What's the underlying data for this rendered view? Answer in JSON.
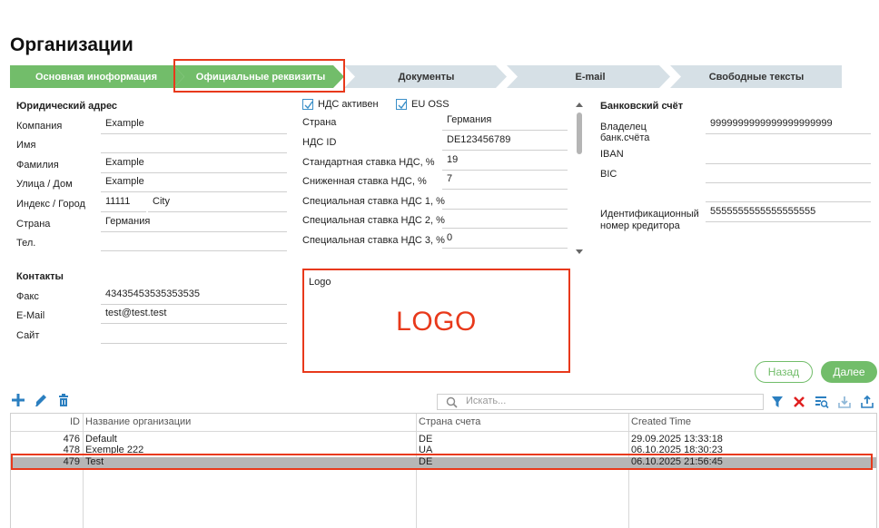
{
  "page": {
    "title": "Организации"
  },
  "steps": [
    {
      "label": "Основная иноформация",
      "state": "done"
    },
    {
      "label": "Официальные реквизиты",
      "state": "active"
    },
    {
      "label": "Документы",
      "state": "todo"
    },
    {
      "label": "E-mail",
      "state": "todo"
    },
    {
      "label": "Свободные тексты",
      "state": "todo"
    }
  ],
  "legal_address": {
    "title": "Юридический адрес",
    "company_label": "Компания",
    "company_value": "Example",
    "first_name_label": "Имя",
    "first_name_value": "",
    "last_name_label": "Фамилия",
    "last_name_value": "Example",
    "street_label": "Улица / Дом",
    "street_value": "Example",
    "zip_city_label": "Индекс / Город",
    "zip_value": "11111",
    "city_value": "City",
    "country_label": "Страна",
    "country_value": "Германия",
    "phone_label": "Тел.",
    "phone_value": ""
  },
  "contacts": {
    "title": "Контакты",
    "fax_label": "Факс",
    "fax_value": "43435453535353535",
    "email_label": "E-Mail",
    "email_value": "test@test.test",
    "site_label": "Сайт",
    "site_value": ""
  },
  "vat": {
    "vat_active_label": "НДС активен",
    "vat_active_checked": true,
    "eu_oss_label": "EU OSS",
    "eu_oss_checked": true,
    "country_label": "Страна",
    "country_value": "Германия",
    "vat_id_label": "НДС ID",
    "vat_id_value": "DE123456789",
    "std_rate_label": "Стандартная ставка НДС, %",
    "std_rate_value": "19",
    "reduced_rate_label": "Сниженная ставка НДС, %",
    "reduced_rate_value": "7",
    "special1_label": "Специальная ставка НДС 1, %",
    "special1_value": "",
    "special2_label": "Специальная ставка НДС 2, %",
    "special2_value": "",
    "special3_label": "Специальная ставка НДС 3, %",
    "special3_value": "0"
  },
  "logo": {
    "label": "Logo",
    "text": "LOGO"
  },
  "bank": {
    "title": "Банковский счёт",
    "owner_label_1": "Владелец",
    "owner_label_2": "банк.счёта",
    "owner_value": "9999999999999999999999",
    "iban_label": "IBAN",
    "iban_value": "",
    "bic_label": "BIC",
    "bic_value": "",
    "creditor_label_1": "Идентификационный",
    "creditor_label_2": "номер кредитора",
    "creditor_value": "5555555555555555555"
  },
  "nav": {
    "back_label": "Назад",
    "next_label": "Далее"
  },
  "toolbar": {
    "search_placeholder": "Искать..."
  },
  "table": {
    "columns": [
      "ID",
      "Название организации",
      "Страна счета",
      "Created Time"
    ],
    "rows": [
      {
        "id": "476",
        "name": "Default",
        "country": "DE",
        "created": "29.09.2025 13:33:18",
        "selected": false
      },
      {
        "id": "478",
        "name": "Exemple 222",
        "country": "UA",
        "created": "06.10.2025 18:30:23",
        "selected": false
      },
      {
        "id": "479",
        "name": "Test",
        "country": "DE",
        "created": "06.10.2025 21:56:45",
        "selected": true
      }
    ]
  },
  "colors": {
    "green": "#72bd6a",
    "step_gray": "#d6e0e6",
    "highlight_red": "#e8391b",
    "icon_blue": "#2b7fc0"
  }
}
